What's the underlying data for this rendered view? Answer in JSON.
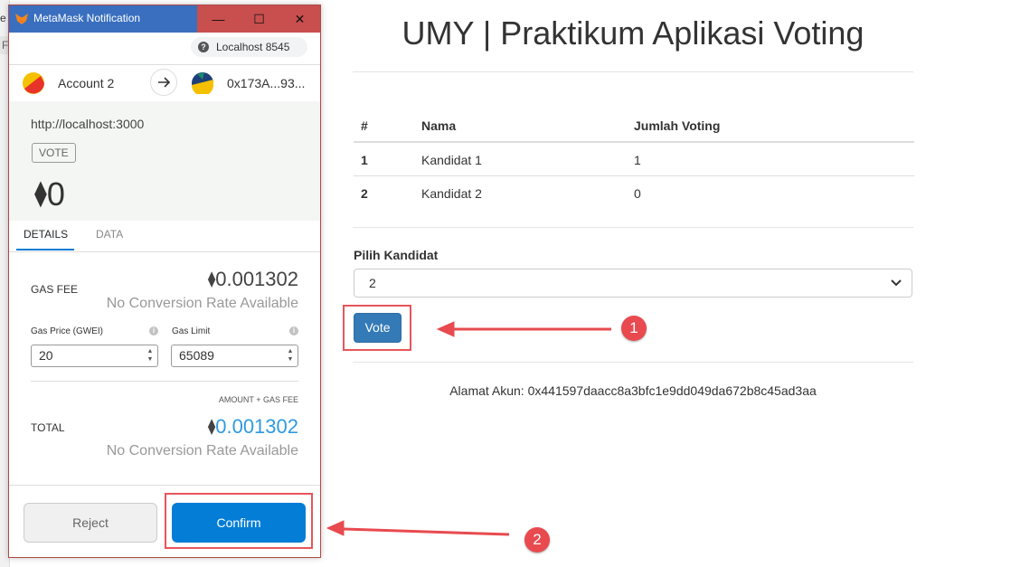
{
  "metamask": {
    "window_title": "MetaMask Notification",
    "window_buttons": [
      "—",
      "☐",
      "✕"
    ],
    "network": "Localhost 8545",
    "from_account": "Account 2",
    "to_address": "0x173A...93...",
    "origin": "http://localhost:3000",
    "method_tag": "VOTE",
    "amount": "0",
    "tabs": [
      "DETAILS",
      "DATA"
    ],
    "gas_fee_label": "GAS FEE",
    "gas_fee_value": "0.001302",
    "no_conversion": "No Conversion Rate Available",
    "gas_price_label": "Gas Price (GWEI)",
    "gas_price_value": "20",
    "gas_limit_label": "Gas Limit",
    "gas_limit_value": "65089",
    "amount_gas_label": "AMOUNT + GAS FEE",
    "total_label": "TOTAL",
    "total_value": "0.001302",
    "reject_label": "Reject",
    "confirm_label": "Confirm"
  },
  "app": {
    "title": "UMY | Praktikum Aplikasi Voting",
    "table": {
      "headers": [
        "#",
        "Nama",
        "Jumlah Voting"
      ],
      "rows": [
        [
          "1",
          "Kandidat 1",
          "1"
        ],
        [
          "2",
          "Kandidat 2",
          "0"
        ]
      ]
    },
    "pilih_label": "Pilih Kandidat",
    "selected_option": "2",
    "vote_button": "Vote",
    "alamat": "Alamat Akun: 0x441597daacc8a3bfc1e9dd049da672b8c45ad3aa"
  },
  "annotations": {
    "step1": "1",
    "step2": "2",
    "color": "#e84a4f"
  },
  "background": {
    "edge_text_1": "e",
    "edge_text_2": "F"
  },
  "colors": {
    "metamask_blue": "#037dd6",
    "bootstrap_primary": "#337ab7",
    "highlight_red": "#e8555b"
  }
}
